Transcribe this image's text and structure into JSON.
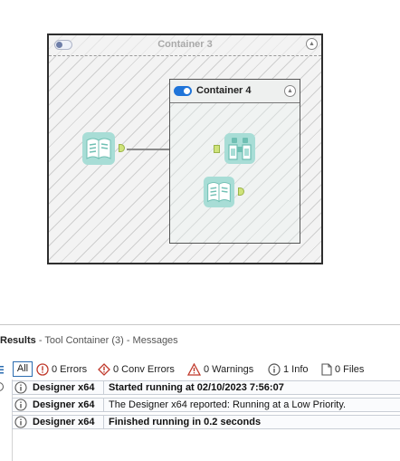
{
  "canvas": {
    "container3": {
      "title": "Container 3",
      "enabled": false
    },
    "container4": {
      "title": "Container 4",
      "enabled": true
    },
    "tools": [
      {
        "name": "input-data-tool",
        "icon": "book-icon"
      },
      {
        "name": "browse-tool",
        "icon": "binoculars-icon"
      },
      {
        "name": "input-data-tool-2",
        "icon": "book-icon"
      }
    ]
  },
  "results": {
    "title": "Results",
    "subtitle": "- Tool Container (3) - Messages",
    "filters": {
      "all": "All",
      "errors": "0 Errors",
      "conv_errors": "0 Conv Errors",
      "warnings": "0 Warnings",
      "info": "1 Info",
      "files": "0 Files"
    },
    "messages": [
      {
        "source": "Designer x64",
        "text": "Started running at 02/10/2023 7:56:07",
        "bold": true
      },
      {
        "source": "Designer x64",
        "text": "The Designer x64 reported: Running at a Low Priority.",
        "bold": false
      },
      {
        "source": "Designer x64",
        "text": "Finished running in 0.2 seconds",
        "bold": true
      }
    ]
  },
  "colors": {
    "accent": "#1f74d9",
    "tool_teal": "#a8ddd6",
    "anchor": "#cfe37a",
    "error": "#c0392b",
    "warning": "#c0392b"
  }
}
